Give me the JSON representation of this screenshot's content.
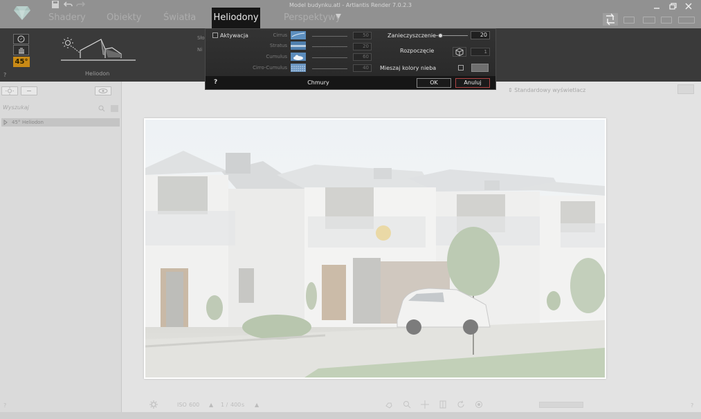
{
  "window": {
    "title": "Model budynku.atl - Artlantis Render 7.0.2.3"
  },
  "menu": {
    "tabs": [
      "Shadery",
      "Obiekty",
      "Światła",
      "Heliodony",
      "Perspektywy"
    ],
    "active_tab": "Heliodony"
  },
  "heliodon_bar": {
    "angle_badge": "45°",
    "label": "Heliodon",
    "help": "?",
    "side_labels": [
      "Sło",
      "Ni"
    ]
  },
  "clouds_dialog": {
    "title": "Chmury",
    "activation_label": "Aktywacja",
    "activation_checked": false,
    "cloud_types": [
      {
        "name": "Cirrus",
        "value": "50"
      },
      {
        "name": "Stratus",
        "value": "20"
      },
      {
        "name": "Cumulus",
        "value": "60"
      },
      {
        "name": "Cirro-Cumulus",
        "value": "40"
      }
    ],
    "occlusion_label": "Zanieczyszczenie",
    "occlusion_value": "20",
    "start_label": "Rozpoczęcie",
    "start_value": "1",
    "mix_label": "Mieszaj kolory nieba",
    "mix_checked": false,
    "mix_color": "#6f6f6f",
    "help": "?",
    "ok_label": "OK",
    "cancel_label": "Anuluj"
  },
  "left_panel": {
    "search_placeholder": "Wyszukaj",
    "tree_items": [
      {
        "angle": "45°",
        "label": "Heliodon"
      }
    ],
    "help": "?"
  },
  "viewport": {
    "display_mode": "Standardowy wyświetlacz"
  },
  "bottom_bar": {
    "iso_label": "ISO",
    "iso_value": "600",
    "shutter_prefix": "1 /",
    "shutter_value": "400",
    "shutter_unit": "s",
    "help": "?"
  },
  "colors": {
    "accent_badge": "#c98a16",
    "active_tab_bg": "#161616",
    "dialog_bg": "#2c2c2c",
    "cancel_border": "#b04545"
  }
}
